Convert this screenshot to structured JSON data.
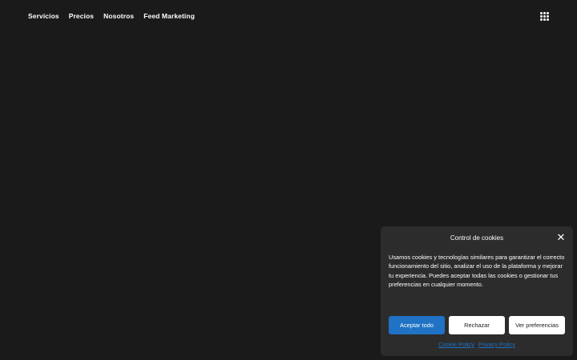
{
  "nav": {
    "items": [
      {
        "label": "Servicios"
      },
      {
        "label": "Precios"
      },
      {
        "label": "Nosotros"
      },
      {
        "label": "Feed Marketing"
      }
    ],
    "apps_icon": "grid-icon"
  },
  "cookie_banner": {
    "title": "Control de cookies",
    "close_icon": "close-icon",
    "message": "Usamos cookies y tecnologías similares para garantizar el correcto funcionamiento del sitio, analizar el uso de la plataforma y mejorar tu experiencia. Puedes aceptar todas las cookies o gestionar tus preferencias en cualquier momento.",
    "accept_label": "Aceptar todo",
    "reject_label": "Rechazar",
    "preferences_label": "Ver preferencias",
    "links": [
      {
        "label": "Cookie Policy"
      },
      {
        "label": "Privacy Policy"
      }
    ]
  },
  "colors": {
    "background": "#1a1a1b",
    "panel": "#2c2c2d",
    "accent": "#1f72c4",
    "text": "#ffffff"
  }
}
